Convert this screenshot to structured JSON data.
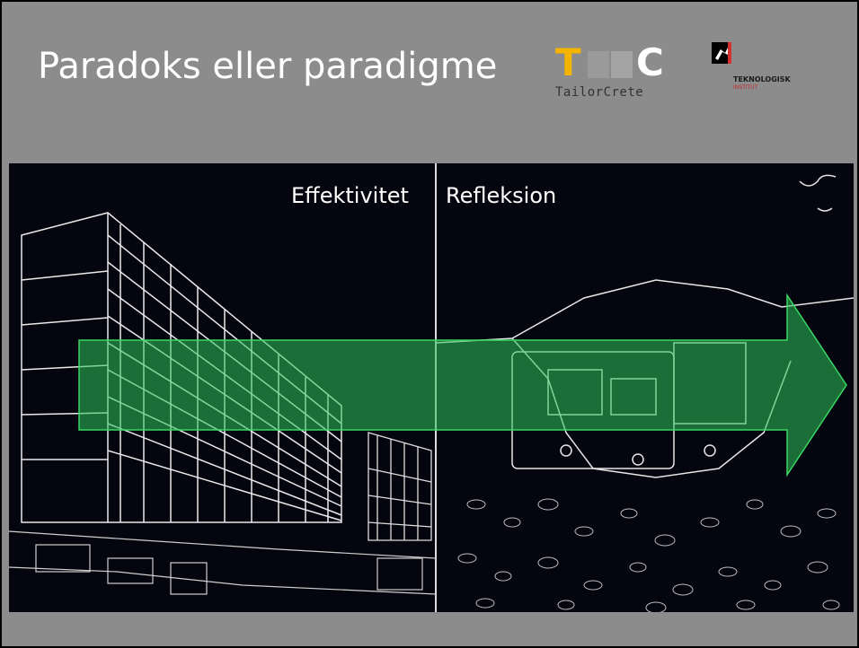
{
  "slide": {
    "title": "Paradoks eller paradigme",
    "labels": {
      "left": "Effektivitet",
      "right": "Refleksion"
    }
  },
  "logos": {
    "tailorcrete": {
      "letter_t": "T",
      "letter_c": "C",
      "name": "TailorCrete"
    },
    "teknologisk_institut": {
      "name": "TEKNOLOGISK",
      "sub": "INSTITUT"
    }
  },
  "colors": {
    "slide_background": "#8c8c8c",
    "photo_background": "#05050f",
    "arrow_fill": "#2ec45a",
    "title_text": "#ffffff"
  }
}
